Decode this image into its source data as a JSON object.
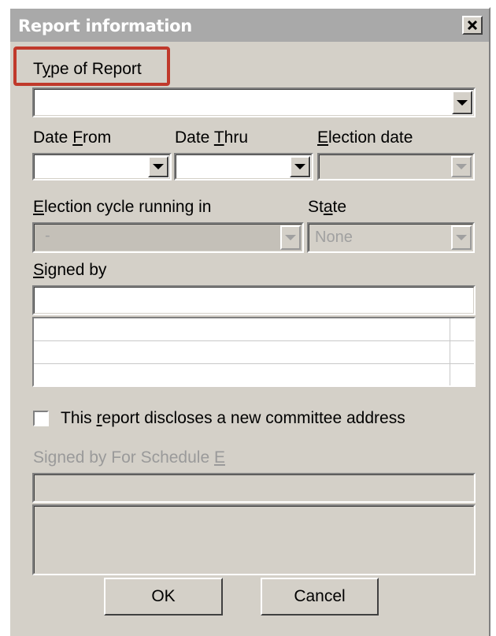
{
  "dialog": {
    "title": "Report information",
    "close_label": "×"
  },
  "type_of_report": {
    "label_pre": "T",
    "label_key": "y",
    "label_post": "pe of Report",
    "value": ""
  },
  "date_from": {
    "label_pre": "Date ",
    "label_key": "F",
    "label_post": "rom",
    "value": ""
  },
  "date_thru": {
    "label_pre": "Date ",
    "label_key": "T",
    "label_post": "hru",
    "value": ""
  },
  "election_date": {
    "label_pre": "",
    "label_key": "E",
    "label_post": "lection date",
    "value": ""
  },
  "election_cycle": {
    "label_pre": "",
    "label_key": "E",
    "label_post": "lection cycle running in",
    "value": "-"
  },
  "state": {
    "label_pre": "St",
    "label_key": "a",
    "label_post": "te",
    "value": "None"
  },
  "signed_by": {
    "label_pre": "",
    "label_key": "S",
    "label_post": "igned by",
    "value": ""
  },
  "new_address": {
    "label_pre": "This ",
    "label_key": "r",
    "label_post": "eport discloses a new committee address",
    "checked": false
  },
  "signed_by_sched_e": {
    "label_pre": "Signed by For Schedule ",
    "label_key": "E",
    "label_post": "",
    "value": ""
  },
  "buttons": {
    "ok": "OK",
    "cancel": "Cancel"
  },
  "colors": {
    "highlight": "#c0392b",
    "face": "#d4d0c8",
    "titlebar": "#a9a9a9"
  }
}
